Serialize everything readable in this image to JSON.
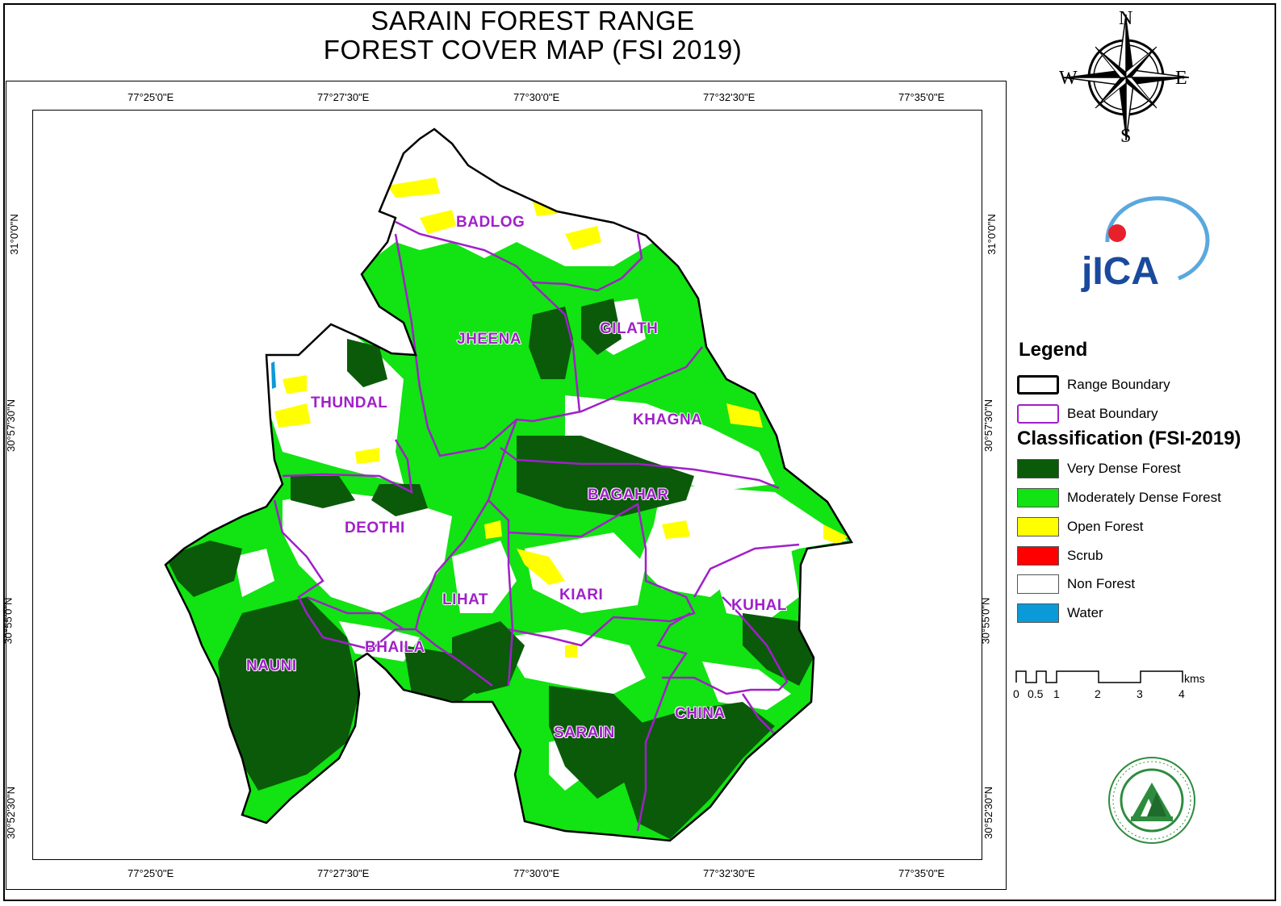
{
  "title": {
    "line1": "SARAIN FOREST RANGE",
    "line2": "FOREST COVER MAP (FSI 2019)"
  },
  "graticule": {
    "top_labels": [
      "77°25'0\"E",
      "77°27'30\"E",
      "77°30'0\"E",
      "77°32'30\"E",
      "77°35'0\"E"
    ],
    "bottom_labels": [
      "77°25'0\"E",
      "77°27'30\"E",
      "77°30'0\"E",
      "77°32'30\"E",
      "77°35'0\"E"
    ],
    "left_labels": [
      "31°0'0\"N",
      "30°57'30\"N",
      "30°55'0\"N",
      "30°52'30\"N"
    ],
    "right_labels": [
      "31°0'0\"N",
      "30°57'30\"N",
      "30°55'0\"N",
      "30°52'30\"N"
    ]
  },
  "beats": [
    "BADLOG",
    "JHEENA",
    "GILATH",
    "THUNDAL",
    "KHAGNA",
    "BAGAHAR",
    "DEOTHI",
    "LIHAT",
    "KIARI",
    "KUHAL",
    "BHAILA",
    "NAUNI",
    "SARAIN",
    "CHINA"
  ],
  "compass": {
    "n": "N",
    "s": "S",
    "e": "E",
    "w": "W"
  },
  "logos": {
    "jica_text": "jICA",
    "emblem_icon": "forest-department-emblem"
  },
  "legend": {
    "title": "Legend",
    "boundaries": [
      {
        "label": "Range Boundary",
        "color": "#000000"
      },
      {
        "label": "Beat Boundary",
        "color": "#a020c8"
      }
    ],
    "classification_title": "Classification (FSI-2019)",
    "classes": [
      {
        "label": "Very Dense Forest",
        "color": "#0a5a0a"
      },
      {
        "label": "Moderately Dense Forest",
        "color": "#12e312"
      },
      {
        "label": "Open Forest",
        "color": "#ffff00"
      },
      {
        "label": "Scrub",
        "color": "#ff0000"
      },
      {
        "label": "Non Forest",
        "color": "#ffffff"
      },
      {
        "label": "Water",
        "color": "#0a9ad8"
      }
    ]
  },
  "scale_bar": {
    "unit": "kms",
    "labels": [
      "0",
      "0.5",
      "1",
      "2",
      "3",
      "4"
    ]
  }
}
